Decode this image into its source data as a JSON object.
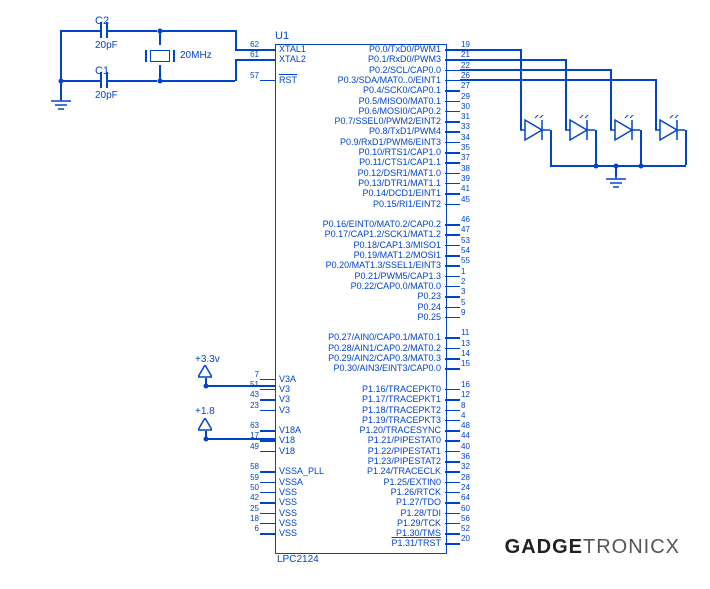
{
  "ref": {
    "u1": "U1",
    "c1": "C1",
    "c2": "C2",
    "c1v": "20pF",
    "c2v": "20pF",
    "xtal": "20MHz",
    "v33": "+3.3v",
    "v18": "+1.8",
    "chip": "LPC2124"
  },
  "brand1": "GADGE",
  "brand2": "TRONICX",
  "leftPins": [
    {
      "num": "62",
      "label": "XTAL1"
    },
    {
      "num": "61",
      "label": "XTAL2"
    },
    {
      "num": "",
      "label": ""
    },
    {
      "num": "57",
      "label": "RST",
      "over": true
    },
    {
      "num": "",
      "label": ""
    },
    {
      "num": "",
      "label": ""
    },
    {
      "num": "",
      "label": ""
    },
    {
      "num": "",
      "label": ""
    },
    {
      "num": "",
      "label": ""
    },
    {
      "num": "",
      "label": ""
    },
    {
      "num": "",
      "label": ""
    },
    {
      "num": "",
      "label": ""
    },
    {
      "num": "",
      "label": ""
    },
    {
      "num": "",
      "label": ""
    },
    {
      "num": "",
      "label": ""
    },
    {
      "num": "",
      "label": ""
    },
    {
      "num": "",
      "label": ""
    },
    {
      "num": "",
      "label": ""
    },
    {
      "num": "",
      "label": ""
    },
    {
      "num": "",
      "label": ""
    },
    {
      "num": "",
      "label": ""
    },
    {
      "num": "",
      "label": ""
    },
    {
      "num": "",
      "label": ""
    },
    {
      "num": "",
      "label": ""
    },
    {
      "num": "",
      "label": ""
    },
    {
      "num": "",
      "label": ""
    },
    {
      "num": "",
      "label": ""
    },
    {
      "num": "",
      "label": ""
    },
    {
      "num": "",
      "label": ""
    },
    {
      "num": "",
      "label": ""
    },
    {
      "num": "",
      "label": ""
    },
    {
      "num": "",
      "label": ""
    },
    {
      "num": "7",
      "label": "V3A"
    },
    {
      "num": "51",
      "label": "V3"
    },
    {
      "num": "43",
      "label": "V3"
    },
    {
      "num": "23",
      "label": "V3"
    },
    {
      "num": "",
      "label": ""
    },
    {
      "num": "63",
      "label": "V18A"
    },
    {
      "num": "17",
      "label": "V18"
    },
    {
      "num": "49",
      "label": "V18"
    },
    {
      "num": "",
      "label": ""
    },
    {
      "num": "58",
      "label": "VSSA_PLL"
    },
    {
      "num": "59",
      "label": "VSSA"
    },
    {
      "num": "50",
      "label": "VSS"
    },
    {
      "num": "42",
      "label": "VSS"
    },
    {
      "num": "25",
      "label": "VSS"
    },
    {
      "num": "18",
      "label": "VSS"
    },
    {
      "num": "6",
      "label": "VSS"
    }
  ],
  "rightPins": [
    {
      "num": "19",
      "label": "P0.0/TxD0/PWM1"
    },
    {
      "num": "21",
      "label": "P0.1/RxD0/PWM3"
    },
    {
      "num": "22",
      "label": "P0.2/SCL/CAP0.0"
    },
    {
      "num": "26",
      "label": "P0.3/SDA/MAT0..0/EINT1"
    },
    {
      "num": "27",
      "label": "P0.4/SCK0/CAP0.1"
    },
    {
      "num": "29",
      "label": "P0.5/MISO0/MAT0.1"
    },
    {
      "num": "30",
      "label": "P0.6/MOSI0/CAP0.2"
    },
    {
      "num": "31",
      "label": "P0.7/SSEL0/PWM2/EINT2"
    },
    {
      "num": "33",
      "label": "P0.8/TxD1/PWM4"
    },
    {
      "num": "34",
      "label": "P0.9/RxD1/PWM6/EINT3"
    },
    {
      "num": "35",
      "label": "P0.10/RTS1/CAP1.0"
    },
    {
      "num": "37",
      "label": "P0.11/CTS1/CAP1.1"
    },
    {
      "num": "38",
      "label": "P0.12/DSR1/MAT1.0"
    },
    {
      "num": "39",
      "label": "P0.13/DTR1/MAT1.1"
    },
    {
      "num": "41",
      "label": "P0.14/DCD1/EINT1"
    },
    {
      "num": "45",
      "label": "P0.15/RI1/EINT2"
    },
    {
      "num": "",
      "label": ""
    },
    {
      "num": "46",
      "label": "P0.16/EINT0/MAT0.2/CAP0.2"
    },
    {
      "num": "47",
      "label": "P0.17/CAP1.2/SCK1/MAT1.2"
    },
    {
      "num": "53",
      "label": "P0.18/CAP1.3/MISO1"
    },
    {
      "num": "54",
      "label": "P0.19/MAT1.2/MOSI1"
    },
    {
      "num": "55",
      "label": "P0.20/MAT1.3/SSEL1/EINT3"
    },
    {
      "num": "1",
      "label": "P0.21/PWM5/CAP1.3"
    },
    {
      "num": "2",
      "label": "P0.22/CAP0.0/MAT0.0"
    },
    {
      "num": "3",
      "label": "P0.23"
    },
    {
      "num": "5",
      "label": "P0.24"
    },
    {
      "num": "9",
      "label": "P0.25"
    },
    {
      "num": "",
      "label": ""
    },
    {
      "num": "11",
      "label": "P0.27/AIN0/CAP0.1/MAT0.1"
    },
    {
      "num": "13",
      "label": "P0.28/AIN1/CAP0.2/MAT0.2"
    },
    {
      "num": "14",
      "label": "P0.29/AIN2/CAP0.3/MAT0.3"
    },
    {
      "num": "15",
      "label": "P0.30/AIN3/EINT3/CAP0.0"
    },
    {
      "num": "",
      "label": ""
    },
    {
      "num": "16",
      "label": "P1.16/TRACEPKT0"
    },
    {
      "num": "12",
      "label": "P1.17/TRACEPKT1"
    },
    {
      "num": "8",
      "label": "P1.18/TRACEPKT2"
    },
    {
      "num": "4",
      "label": "P1.19/TRACEPKT3"
    },
    {
      "num": "48",
      "label": "P1.20/TRACESYNC"
    },
    {
      "num": "44",
      "label": "P1.21/PIPESTAT0"
    },
    {
      "num": "40",
      "label": "P1.22/PIPESTAT1"
    },
    {
      "num": "36",
      "label": "P1.23/PIPESTAT2"
    },
    {
      "num": "32",
      "label": "P1.24/TRACECLK"
    },
    {
      "num": "28",
      "label": "P1.25/EXTIN0"
    },
    {
      "num": "24",
      "label": "P1.26/RTCK"
    },
    {
      "num": "64",
      "label": "P1.27/TDO"
    },
    {
      "num": "60",
      "label": "P1.28/TDI"
    },
    {
      "num": "56",
      "label": "P1.29/TCK"
    },
    {
      "num": "52",
      "label": "P1.30/TMS"
    },
    {
      "num": "20",
      "label": "P1.31/TRST",
      "over": true
    }
  ]
}
